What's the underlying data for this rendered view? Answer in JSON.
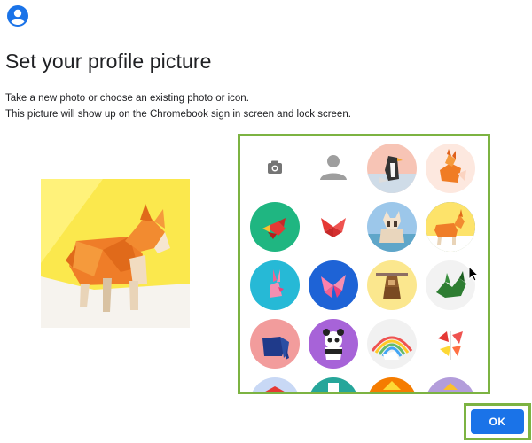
{
  "header": {
    "account_icon": "account-circle-icon",
    "title": "Set your profile picture"
  },
  "description": {
    "line1": "Take a new photo or choose an existing photo or icon.",
    "line2": "This picture will show up on the Chromebook sign in screen and lock screen."
  },
  "preview": {
    "image": "origami-corgi"
  },
  "picker": {
    "items": [
      {
        "name": "camera-icon",
        "bg": ""
      },
      {
        "name": "default-profile-icon",
        "bg": ""
      },
      {
        "name": "penguin-avatar",
        "bg": "#f7c4b5"
      },
      {
        "name": "fox-avatar",
        "bg": "#ffffff"
      },
      {
        "name": "bird-avatar",
        "bg": "#1fb681"
      },
      {
        "name": "butterfly-avatar",
        "bg": "#ffffff"
      },
      {
        "name": "cat-avatar",
        "bg": "#9cc7ea"
      },
      {
        "name": "corgi-avatar",
        "bg": "#fde36a"
      },
      {
        "name": "rabbit-avatar",
        "bg": "#26b9d6"
      },
      {
        "name": "butterfly-blue-avatar",
        "bg": "#1e63d6"
      },
      {
        "name": "monkey-avatar",
        "bg": "#fbe78e"
      },
      {
        "name": "dragon-avatar",
        "bg": "#f2f2f2"
      },
      {
        "name": "elephant-avatar",
        "bg": "#f29c9c"
      },
      {
        "name": "panda-avatar",
        "bg": "#a763d8"
      },
      {
        "name": "unicorn-avatar",
        "bg": "#f1f1f1"
      },
      {
        "name": "cardinal-avatar",
        "bg": "#ffffff"
      },
      {
        "name": "partial-avatar-1",
        "bg": "#c8d8f5"
      },
      {
        "name": "partial-avatar-2",
        "bg": "#26a69a"
      },
      {
        "name": "partial-avatar-3",
        "bg": "#f57c00"
      },
      {
        "name": "partial-avatar-4",
        "bg": "#b39ddb"
      }
    ],
    "selected_index": 7
  },
  "actions": {
    "ok_label": "OK"
  },
  "colors": {
    "accent": "#1a73e8",
    "highlight": "#7cb342"
  }
}
